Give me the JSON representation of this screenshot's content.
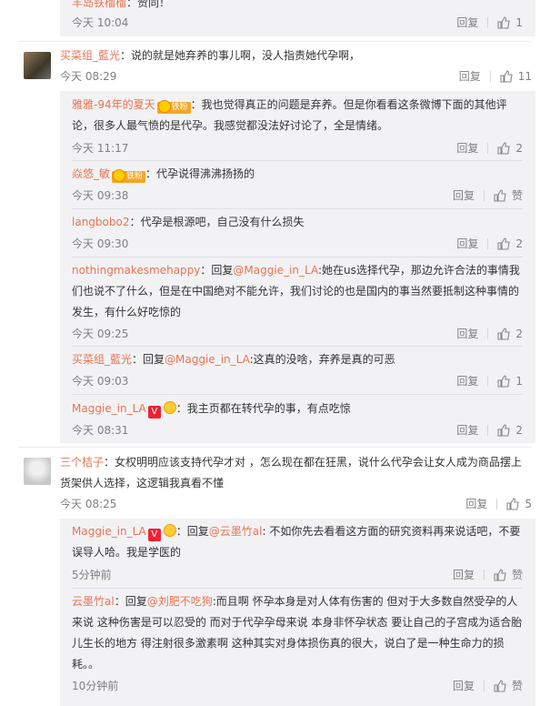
{
  "top_partial": {
    "name": "羊岛铁榴榴",
    "text": "：赞同！",
    "time": "今天 10:04",
    "reply": "回复",
    "likes": "1"
  },
  "comment1": {
    "name": "买菜组_藍光",
    "text": "：说的就是她弃养的事儿啊，没人指责她代孕啊，",
    "time": "今天 08:29",
    "reply": "回复",
    "likes": "11",
    "replies": [
      {
        "name": "雅雅-94年的夏天",
        "badge": "铁粉",
        "text": "：我也觉得真正的问题是弃养。但是你看看这条微博下面的其他评论，很多人最气愤的是代孕。我感觉都没法好讨论了，全是情绪。",
        "time": "今天 11:17",
        "reply": "回复",
        "likes": "2"
      },
      {
        "name": "焱悠_敏",
        "badge": "铁粉",
        "text": "：代孕说得沸沸扬扬的",
        "time": "今天 09:38",
        "reply": "回复",
        "likes": "赞"
      },
      {
        "name": "langbobo2",
        "text": "：代孕是根源吧，自己没有什么损失",
        "time": "今天 09:30",
        "reply": "回复",
        "likes": "2"
      },
      {
        "name": "nothingmakesmehappy",
        "pre": "：回复",
        "at": "@Maggie_in_LA",
        "text": ":她在us选择代孕，那边允许合法的事情我们也说不了什么，但是在中国绝对不能允许，我们讨论的也是国内的事当然要抵制这种事情的发生，有什么好吃惊的",
        "time": "今天 09:25",
        "reply": "回复",
        "likes": "2"
      },
      {
        "name": "买菜组_藍光",
        "pre": "：回复",
        "at": "@Maggie_in_LA",
        "text": ":这真的没啥，弃养是真的可恶",
        "time": "今天 09:03",
        "reply": "回复",
        "likes": "1"
      },
      {
        "name": "Maggie_in_LA",
        "vbadge": "V",
        "text": "：我主页都在转代孕的事，有点吃惊",
        "time": "今天 08:31",
        "reply": "回复",
        "likes": "2"
      }
    ]
  },
  "comment2": {
    "name": "三个桔子",
    "text": "：女权明明应该支持代孕才对 ，怎么现在都在狂黑，说什么代孕会让女人成为商品摆上货架供人选择，这逻辑我真看不懂",
    "time": "今天 08:25",
    "reply": "回复",
    "likes": "5",
    "replies": [
      {
        "name": "Maggie_in_LA",
        "vbadge": "V",
        "pre": "：回复",
        "at": "@云墨竹al",
        "text": ": 不如你先去看看这方面的研究资料再来说话吧，不要误导人哈。我是学医的",
        "time": "5分钟前",
        "reply": "回复",
        "likes": "赞"
      },
      {
        "name": "云墨竹al",
        "pre": "：回复",
        "at": "@刘肥不吃狗",
        "text": ":而且啊  怀孕本身是对人体有伤害的  但对于大多数自然受孕的人来说  这种伤害是可以忍受的     而对于代孕孕母来说  本身非怀孕状态  要让自己的子宫成为适合胎儿生长的地方  得注射很多激素啊  这种其实对身体损伤真的很大，说白了是一种生命力的损耗。。",
        "time": "10分钟前",
        "reply": "回复",
        "likes": "赞"
      }
    ]
  },
  "icons": {
    "like": "thumbs-up-icon",
    "vip": "vip-badge-icon",
    "fan": "fan-badge-icon",
    "emoji": "emoji-icon"
  },
  "colors": {
    "name": "#eb7350",
    "meta": "#808080",
    "sub_bg": "#f2f2f5"
  }
}
